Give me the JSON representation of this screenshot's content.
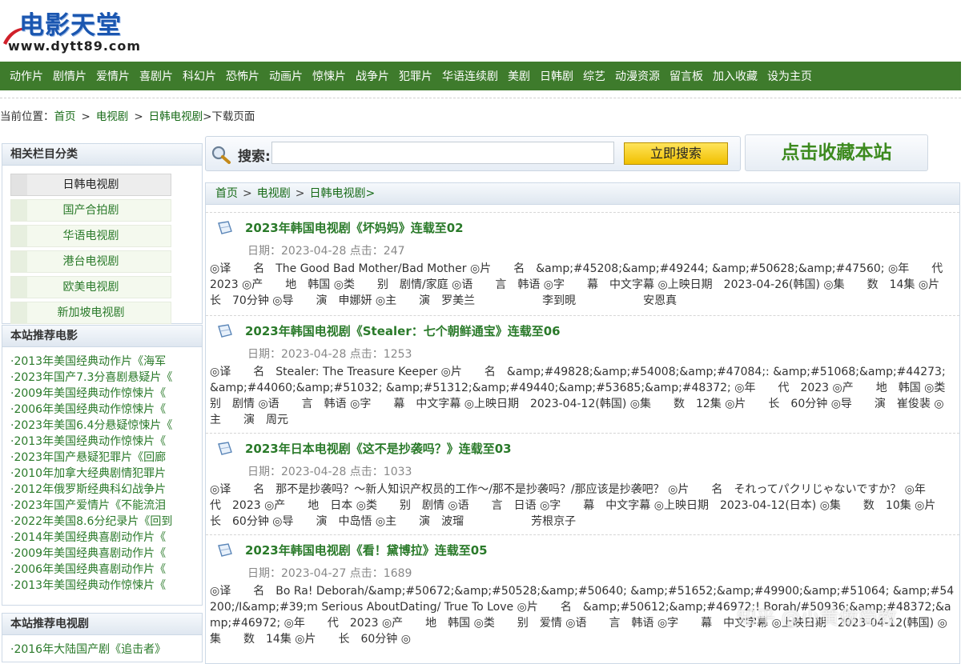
{
  "logo": {
    "title": "电影天堂",
    "url": "www.dytt89.com"
  },
  "nav": [
    "动作片",
    "剧情片",
    "爱情片",
    "喜剧片",
    "科幻片",
    "恐怖片",
    "动画片",
    "惊悚片",
    "战争片",
    "犯罪片",
    "华语连续剧",
    "美剧",
    "日韩剧",
    "综艺",
    "动漫资源",
    "留言板",
    "加入收藏",
    "设为主页"
  ],
  "breadcrumb": {
    "prefix": "当前位置：",
    "home": "首页",
    "sep": ">",
    "tv": "电视剧",
    "jk": "日韩电视剧",
    "current": ">下载页面"
  },
  "sidebar": {
    "categories_title": "相关栏目分类",
    "categories": [
      "日韩电视剧",
      "国产合拍剧",
      "华语电视剧",
      "港台电视剧",
      "欧美电视剧",
      "新加坡电视剧"
    ],
    "movies_title": "本站推荐电影",
    "movies": [
      "2013年美国经典动作片《海军",
      "2023年国产7.3分喜剧悬疑片《",
      "2009年美国经典动作惊悚片《",
      "2006年美国经典动作惊悚片《",
      "2023年美国6.4分悬疑惊悚片《",
      "2013年美国经典动作惊悚片《",
      "2023年国产悬疑犯罪片《回廊",
      "2010年加拿大经典剧情犯罪片",
      "2012年俄罗斯经典科幻战争片",
      "2023年国产爱情片《不能流泪",
      "2022年美国8.6分纪录片《回到",
      "2014年美国经典喜剧动作片《",
      "2009年美国经典喜剧动作片《",
      "2006年美国经典喜剧动作片《",
      "2013年美国经典动作惊悚片《"
    ],
    "tv_title": "本站推荐电视剧",
    "tv": [
      "2016年大陆国产剧《追击者》"
    ]
  },
  "search": {
    "label": "搜索:",
    "value": "",
    "button": "立即搜索"
  },
  "favorite": "点击收藏本站",
  "panel_crumb": {
    "home": "首页",
    "sep": ">",
    "tv": "电视剧",
    "jk": "日韩电视剧>"
  },
  "items": [
    {
      "title": "2023年韩国电视剧《坏妈妈》连载至02",
      "meta": "日期：2023-04-28 点击：247",
      "desc": "◎译　　名　The Good Bad Mother/Bad Mother ◎片　　名　&amp;#45208;&amp;#49244; &amp;#50628;&amp;#47560; ◎年　　代　2023 ◎产　　地　韩国 ◎类　　别　剧情/家庭 ◎语　　言　韩语 ◎字　　幕　中文字幕 ◎上映日期　2023-04-26(韩国) ◎集　　数　14集 ◎片　　长　70分钟 ◎导　　演　申娜妍 ◎主　　演　罗美兰　　　　　　李到晛　　　　　　安恩真"
    },
    {
      "title": "2023年韩国电视剧《Stealer：七个朝鲜通宝》连载至06",
      "meta": "日期：2023-04-28 点击：1253",
      "desc": "◎译　　名　Stealer: The Treasure Keeper ◎片　　名　&amp;#49828;&amp;#54008;&amp;#47084;: &amp;#51068;&amp;#44273; &amp;#44060;&amp;#51032; &amp;#51312;&amp;#49440;&amp;#53685;&amp;#48372; ◎年　　代　2023 ◎产　　地　韩国 ◎类　　别　剧情 ◎语　　言　韩语 ◎字　　幕　中文字幕 ◎上映日期　2023-04-12(韩国) ◎集　　数　12集 ◎片　　长　60分钟 ◎导　　演　崔俊裴 ◎主　　演　周元"
    },
    {
      "title": "2023年日本电视剧《这不是抄袭吗？》连载至03",
      "meta": "日期：2023-04-28 点击：1033",
      "desc": "◎译　　名　那不是抄袭吗？～新人知识产权员的工作～/那不是抄袭吗？/那应该是抄袭吧？ ◎片　　名　それってパクリじゃないですか？ ◎年　　代　2023 ◎产　　地　日本 ◎类　　别　剧情 ◎语　　言　日语 ◎字　　幕　中文字幕 ◎上映日期　2023-04-12(日本) ◎集　　数　10集 ◎片　　长　60分钟 ◎导　　演　中岛悟 ◎主　　演　波瑠　　　　　　芳根京子"
    },
    {
      "title": "2023年韩国电视剧《看！黛博拉》连载至05",
      "meta": "日期：2023-04-27 点击：1689",
      "desc": "◎译　　名　Bo Ra! Deborah/&amp;#50672;&amp;#50528;&amp;#50640; &amp;#51652;&amp;#49900;&amp;#51064; &amp;#54200;/I&amp;#39;m Serious AboutDating/ True To Love ◎片　　名　&amp;#50612;&amp;#46972;! Borah/#50936;&amp;#48372;&amp;#46972; ◎年　　代　2023 ◎产　　地　韩国 ◎类　　别　爱情 ◎语　　言　韩语 ◎字　　幕　中文字幕 ◎上映日期　2023-04-12(韩国) ◎集　　数　14集 ◎片　　长　60分钟 ◎"
    }
  ],
  "watermark": "知乎 @小黄做简教"
}
